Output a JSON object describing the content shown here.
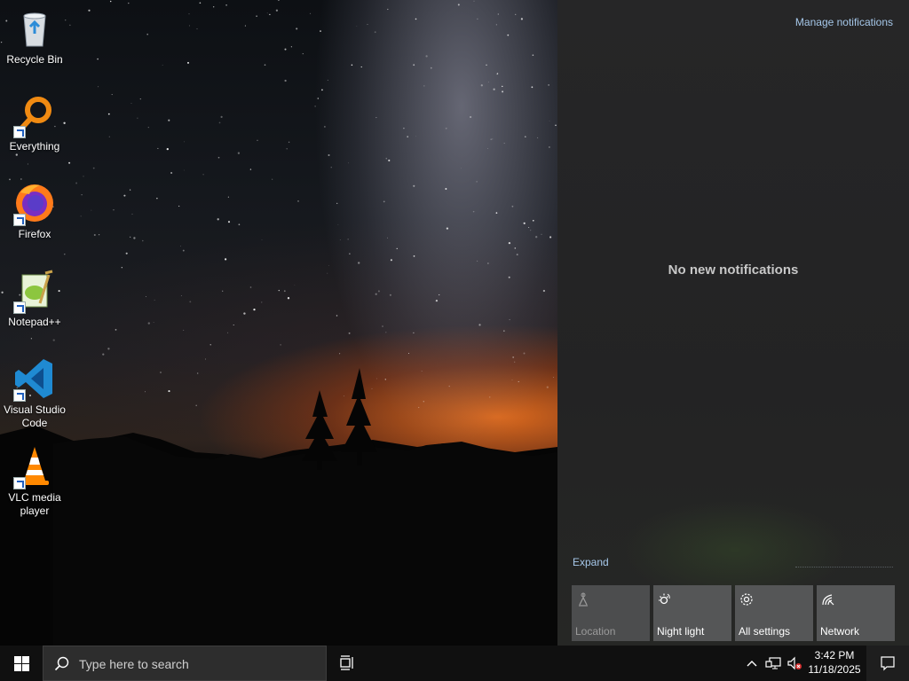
{
  "desktop": {
    "icons": [
      {
        "label": "Recycle Bin",
        "icon": "recycle-bin-icon"
      },
      {
        "label": "Everything",
        "icon": "everything-search-icon"
      },
      {
        "label": "Firefox",
        "icon": "firefox-icon"
      },
      {
        "label": "Notepad++",
        "icon": "notepad-plus-plus-icon"
      },
      {
        "label": "Visual Studio Code",
        "icon": "vscode-icon"
      },
      {
        "label": "VLC media player",
        "icon": "vlc-icon"
      }
    ]
  },
  "action_center": {
    "manage_label": "Manage notifications",
    "empty_message": "No new notifications",
    "expand_label": "Expand",
    "quick_actions": [
      {
        "label": "Location",
        "icon": "location-icon",
        "enabled": false
      },
      {
        "label": "Night light",
        "icon": "night-light-icon",
        "enabled": true
      },
      {
        "label": "All settings",
        "icon": "gear-icon",
        "enabled": true
      },
      {
        "label": "Network",
        "icon": "network-icon",
        "enabled": true
      }
    ]
  },
  "taskbar": {
    "search_placeholder": "Type here to search",
    "time": "3:42 PM",
    "date": "11/18/2025",
    "tray_icons": [
      "chevron-up-icon",
      "network-wired-icon",
      "volume-muted-icon"
    ]
  },
  "colors": {
    "link": "#a6c8ea",
    "taskbar": "#101010",
    "tile": "#555657",
    "panel": "#242425"
  }
}
